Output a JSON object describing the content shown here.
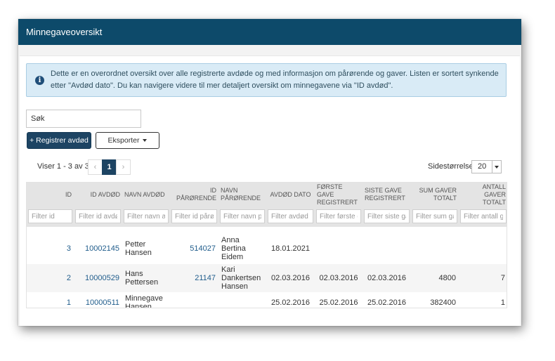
{
  "window": {
    "title": "Minnegaveoversikt"
  },
  "info": {
    "icon": "info-circle-icon",
    "text": "Dette er en overordnet oversikt over alle registrerte avdøde og med informasjon om pårørende og gaver. Listen er sortert synkende etter \"Avdød dato\". Du kan navigere videre til mer detaljert oversikt om minnegavene via \"ID avdød\"."
  },
  "search": {
    "placeholder": "Søk"
  },
  "actions": {
    "register_label": "+ Registrer avdød",
    "export_label": "Eksporter"
  },
  "pagination": {
    "summary": "Viser 1 - 3 av 3",
    "prev": "‹",
    "current": "1",
    "next": "›"
  },
  "page_size": {
    "label": "Sidestørrelse:",
    "value": "20"
  },
  "table": {
    "headers": {
      "id": "ID",
      "id_avdod": "ID AVDØD",
      "navn_avdod": "NAVN AVDØD",
      "id_parorende": "ID PÅRØRENDE",
      "navn_parorende": "NAVN PÅRØRENDE",
      "avdod_dato": "AVDØD DATO",
      "forste_gave": "FØRSTE GAVE REGISTRERT",
      "siste_gave": "SISTE GAVE REGISTRERT",
      "sum_gaver": "SUM GAVER TOTALT",
      "antall_gaver": "ANTALL GAVER TOTALT"
    },
    "filters": {
      "id": "Filter id",
      "id_avdod": "Filter id avdød",
      "navn_avdod": "Filter navn avdød",
      "id_parorende": "Filter id pårørende",
      "navn_parorende": "Filter navn pårørende",
      "avdod_dato": "Filter avdød dato",
      "forste_gave": "Filter første gave",
      "siste_gave": "Filter siste gave",
      "sum_gaver": "Filter sum gaver",
      "antall_gaver": "Filter antall gaver"
    },
    "rows": [
      {
        "id": "3",
        "id_avdod": "10002145",
        "navn_avdod": "Petter Hansen",
        "id_parorende": "514027",
        "navn_parorende": "Anna Bertina Eidem",
        "avdod_dato": "18.01.2021",
        "forste_gave": "",
        "siste_gave": "",
        "sum_gaver": "",
        "antall_gaver": ""
      },
      {
        "id": "2",
        "id_avdod": "10000529",
        "navn_avdod": "Hans Pettersen",
        "id_parorende": "21147",
        "navn_parorende": "Kari Dankertsen Hansen",
        "avdod_dato": "02.03.2016",
        "forste_gave": "02.03.2016",
        "siste_gave": "02.03.2016",
        "sum_gaver": "4800",
        "antall_gaver": "7"
      },
      {
        "id": "1",
        "id_avdod": "10000511",
        "navn_avdod": "Minnegave Hansen",
        "id_parorende": "",
        "navn_parorende": "",
        "avdod_dato": "25.02.2016",
        "forste_gave": "25.02.2016",
        "siste_gave": "25.02.2016",
        "sum_gaver": "382400",
        "antall_gaver": "1"
      }
    ]
  }
}
